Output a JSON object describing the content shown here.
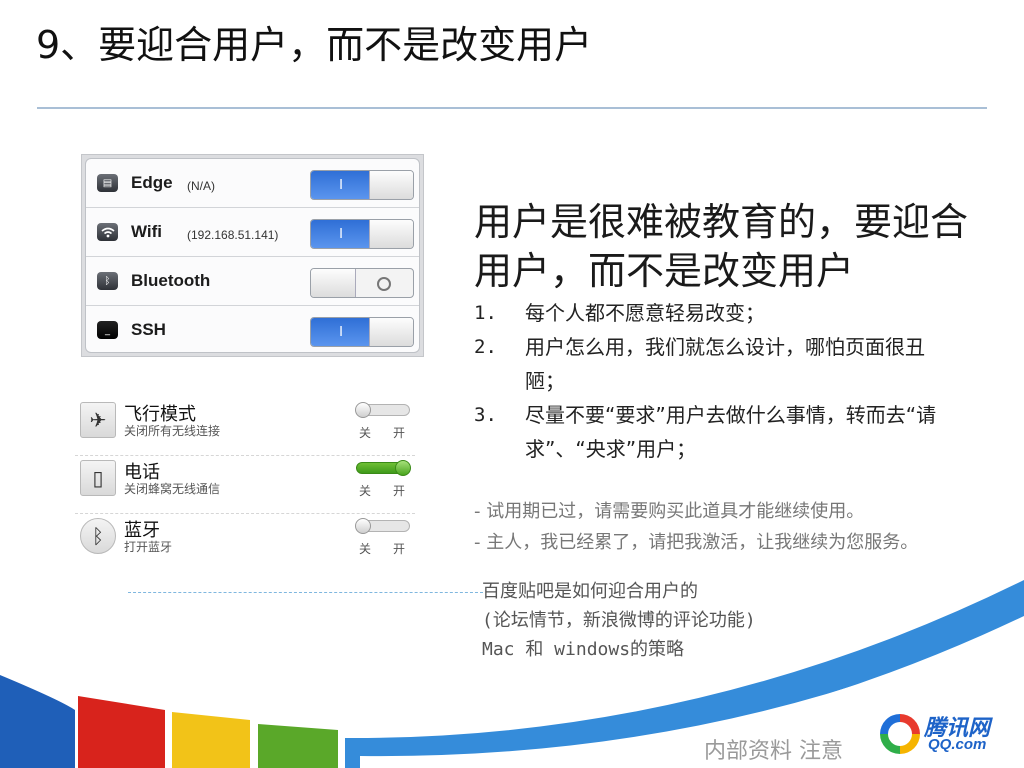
{
  "slide": {
    "title": "9、要迎合用户，而不是改变用户"
  },
  "ios_settings": [
    {
      "label": "Edge",
      "detail": "(N/A)",
      "state": "on",
      "icon": "cellular-data-icon"
    },
    {
      "label": "Wifi",
      "detail": "(192.168.51.141)",
      "state": "on",
      "icon": "wifi-icon"
    },
    {
      "label": "Bluetooth",
      "detail": "",
      "state": "off",
      "icon": "bluetooth-icon"
    },
    {
      "label": "SSH",
      "detail": "",
      "state": "on",
      "icon": "terminal-icon"
    }
  ],
  "ios_switch_on_glyph": "I",
  "android_settings": [
    {
      "title": "飞行模式",
      "subtitle": "关闭所有无线连接",
      "state": "off",
      "icon": "airplane-icon",
      "off_label": "关",
      "on_label": "开"
    },
    {
      "title": "电话",
      "subtitle": "关闭蜂窝无线通信",
      "state": "on",
      "icon": "phone-icon",
      "off_label": "关",
      "on_label": "开"
    },
    {
      "title": "蓝牙",
      "subtitle": "打开蓝牙",
      "state": "off",
      "icon": "bluetooth-icon",
      "off_label": "关",
      "on_label": "开"
    }
  ],
  "main": {
    "heading": "用户是很难被教育的，要迎合用户，而不是改变用户",
    "points": [
      {
        "num": "1.",
        "text": "每个人都不愿意轻易改变；"
      },
      {
        "num": "2.",
        "text": "用户怎么用，我们就怎么设计，哪怕页面很丑陋；"
      },
      {
        "num": "3.",
        "text": "尽量不要“要求”用户去做什么事情，转而去“请求”、“央求”用户；"
      }
    ],
    "quotes": [
      "- 试用期已过，请需要购买此道具才能继续使用。",
      "- 主人，我已经累了，请把我激活，让我继续为您服务。"
    ],
    "notes": [
      "百度贴吧是如何迎合用户的",
      "(论坛情节，新浪微博的评论功能)",
      "Mac 和 windows的策略"
    ]
  },
  "footer": {
    "text": "内部资料 注意"
  },
  "logo": {
    "cn": "腾讯网",
    "en": "QQ.com"
  },
  "colors": {
    "ios_on": "#2f6fd6",
    "android_on": "#4aa51e",
    "band_blue": "#1f7fd6",
    "band_red": "#d8231c",
    "band_yellow": "#f2c318",
    "band_green": "#5aa829"
  }
}
